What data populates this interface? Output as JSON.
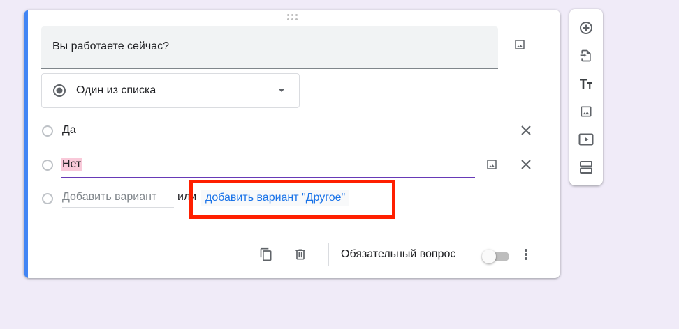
{
  "question": {
    "title": "Вы работаете сейчас?",
    "type": "Один из списка"
  },
  "options": [
    {
      "label": "Да"
    },
    {
      "label": "Нет"
    }
  ],
  "add_option": {
    "placeholder": "Добавить вариант",
    "or": "или",
    "add_other": "добавить вариант \"Другое\""
  },
  "footer": {
    "required_label": "Обязательный вопрос",
    "required_on": false
  },
  "colors": {
    "accent": "#4285f4",
    "primary": "#673ab7",
    "link": "#1a73e8",
    "annotation": "#ff1f00"
  },
  "icons": {
    "toolbar": [
      "add-question-icon",
      "import-questions-icon",
      "title-text-icon",
      "add-image-icon",
      "add-video-icon",
      "add-section-icon"
    ],
    "card": [
      "drag-handle-icon",
      "image-icon",
      "radio-icon",
      "close-icon",
      "copy-icon",
      "trash-icon",
      "more-vert-icon"
    ]
  }
}
